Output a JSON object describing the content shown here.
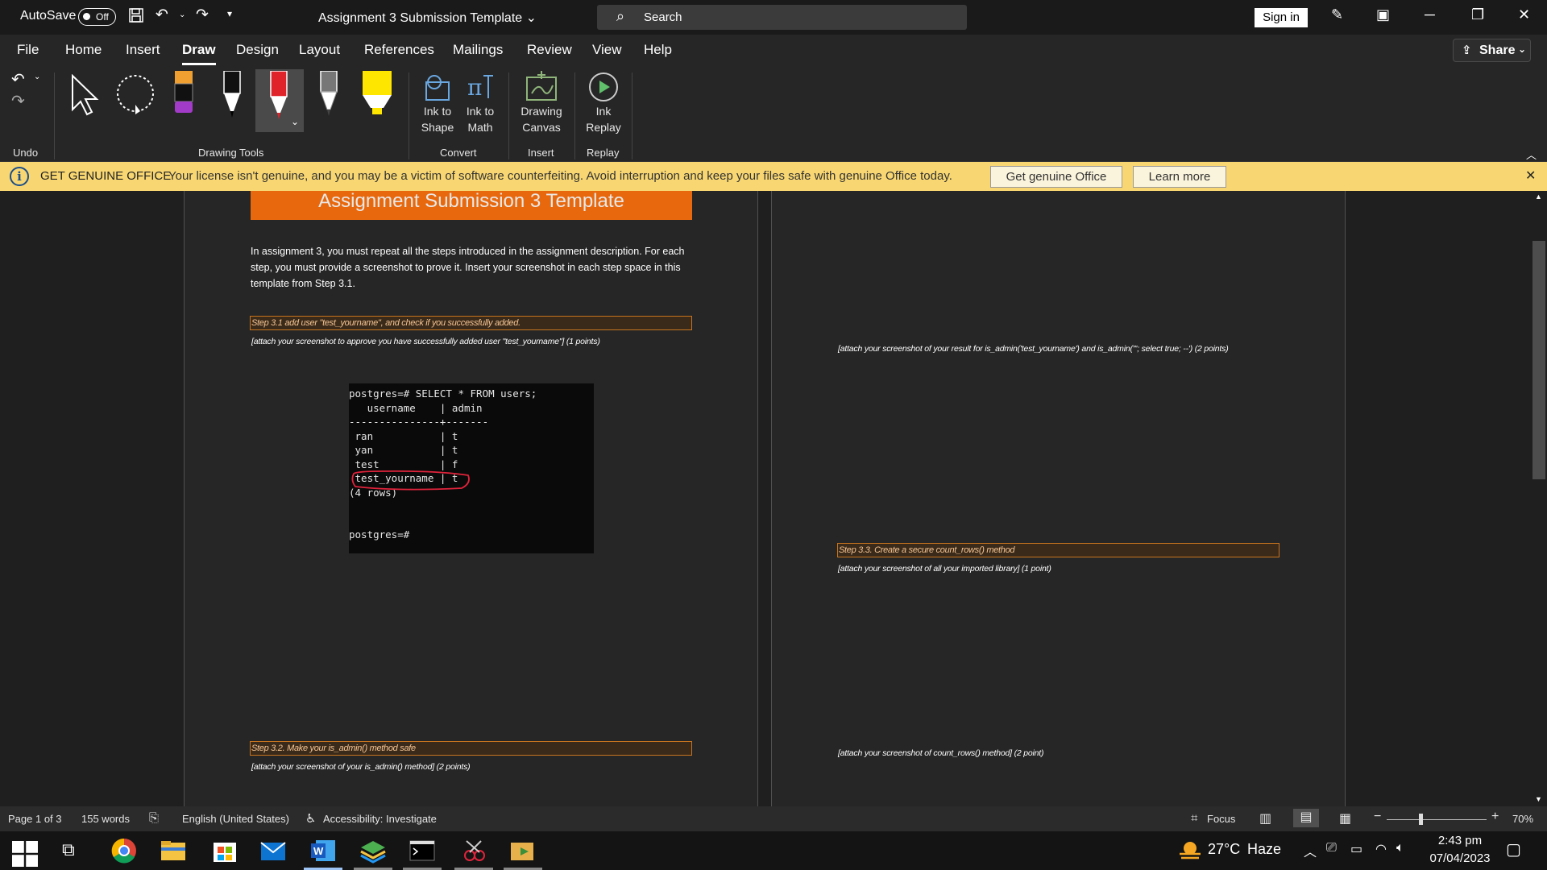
{
  "titlebar": {
    "autosave_label": "AutoSave",
    "autosave_state": "Off",
    "document_title": "Assignment 3 Submission Template",
    "search_placeholder": "Search",
    "sign_in": "Sign in"
  },
  "menu": {
    "tabs": [
      "File",
      "Home",
      "Insert",
      "Draw",
      "Design",
      "Layout",
      "References",
      "Mailings",
      "Review",
      "View",
      "Help"
    ],
    "active_tab": "Draw",
    "share_label": "Share"
  },
  "ribbon": {
    "groups": {
      "undo": "Undo",
      "drawing_tools": "Drawing Tools",
      "convert": "Convert",
      "insert": "Insert",
      "replay": "Replay"
    },
    "buttons": {
      "ink_to_shape": [
        "Ink to",
        "Shape"
      ],
      "ink_to_math": [
        "Ink to",
        "Math"
      ],
      "drawing_canvas": [
        "Drawing",
        "Canvas"
      ],
      "ink_replay": [
        "Ink",
        "Replay"
      ]
    }
  },
  "genuine_bar": {
    "heading": "GET GENUINE OFFICE",
    "message": "Your license isn't genuine, and you may be a victim of software counterfeiting. Avoid interruption and keep your files safe with genuine Office today.",
    "get_button": "Get genuine Office",
    "learn_button": "Learn more"
  },
  "document": {
    "banner": "Assignment Submission 3 Template",
    "intro": "In assignment 3, you must repeat all the steps introduced in the assignment description. For each step, you must provide a screenshot to prove it. Insert your screenshot in each step space in this template from Step 3.1.",
    "step31": "Step 3.1 add user \"test_yourname\", and check if you successfully added.",
    "step31_note": "[attach your screenshot to approve you have successfully added user \"test_yourname\"] (1 points)",
    "step32": "Step 3.2. Make your is_admin() method safe",
    "step32_note": "[attach your screenshot of your is_admin() method] (2 points)",
    "right_note1": "[attach your screenshot of your result for is_admin('test_yourname') and is_admin('''; select true; --') (2 points)",
    "step33": "Step 3.3. Create a secure count_rows() method",
    "step33_note": "[attach your screenshot of all your imported library] (1 point)",
    "right_note2": "[attach your screenshot of count_rows() method] (2 point)"
  },
  "terminal": {
    "lines": [
      "postgres=# SELECT * FROM users;",
      "   username    | admin",
      "---------------+-------",
      " ran           | t",
      " yan           | t",
      " test          | f",
      " test_yourname | t",
      "(4 rows)",
      "",
      "",
      "postgres=#"
    ]
  },
  "statusbar": {
    "page": "Page 1 of 3",
    "words": "155 words",
    "language": "English (United States)",
    "accessibility": "Accessibility: Investigate",
    "focus": "Focus",
    "zoom": "70%"
  },
  "taskbar": {
    "weather_temp": "27°C",
    "weather_desc": "Haze",
    "time": "2:43 pm",
    "date": "07/04/2023"
  },
  "colors": {
    "accent_orange": "#e8680d",
    "genuine_yellow": "#f8d772",
    "pen_red": "#e0232b",
    "highlighter_yellow": "#ffe600"
  }
}
